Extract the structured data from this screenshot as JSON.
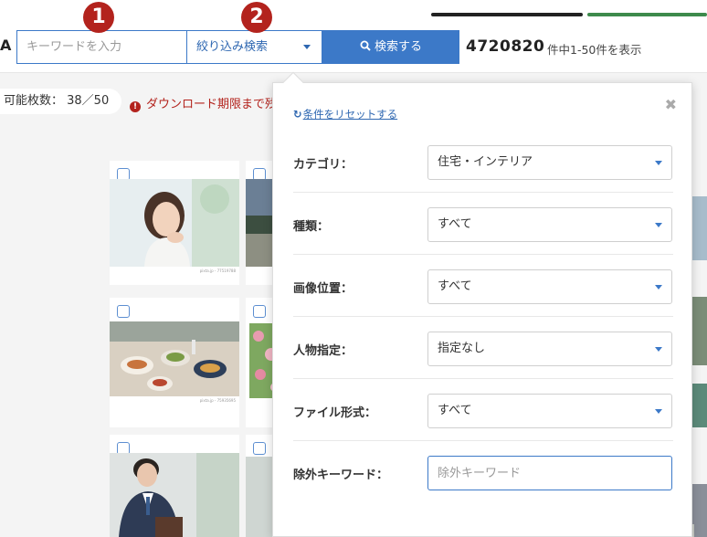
{
  "annotations": {
    "badge1": "1",
    "badge2": "2"
  },
  "header": {
    "logo_fragment": "A",
    "keyword_placeholder": "キーワードを入力",
    "filter_label": "絞り込み検索",
    "search_label": "検索する",
    "result_total": "4720820",
    "result_suffix": "件中1-50件を表示"
  },
  "status": {
    "download_count": "可能枚数： 38／50",
    "warning": "ダウンロード期限まで残"
  },
  "thumbnails": {
    "credit": "pixta.jp - 77519788",
    "credit2": "pixta.jp - 75935695"
  },
  "filter_panel": {
    "reset_label": "条件をリセットする",
    "close_icon": "close-icon",
    "rows": [
      {
        "label": "カテゴリ：",
        "value": "住宅・インテリア"
      },
      {
        "label": "種類：",
        "value": "すべて"
      },
      {
        "label": "画像位置：",
        "value": "すべて"
      },
      {
        "label": "人物指定：",
        "value": "指定なし"
      },
      {
        "label": "ファイル形式：",
        "value": "すべて"
      }
    ],
    "exclude_label": "除外キーワード：",
    "exclude_placeholder": "除外キーワード"
  },
  "colors": {
    "accent": "#3c79c8",
    "badge": "#b3231d",
    "warning": "#b3231d"
  }
}
